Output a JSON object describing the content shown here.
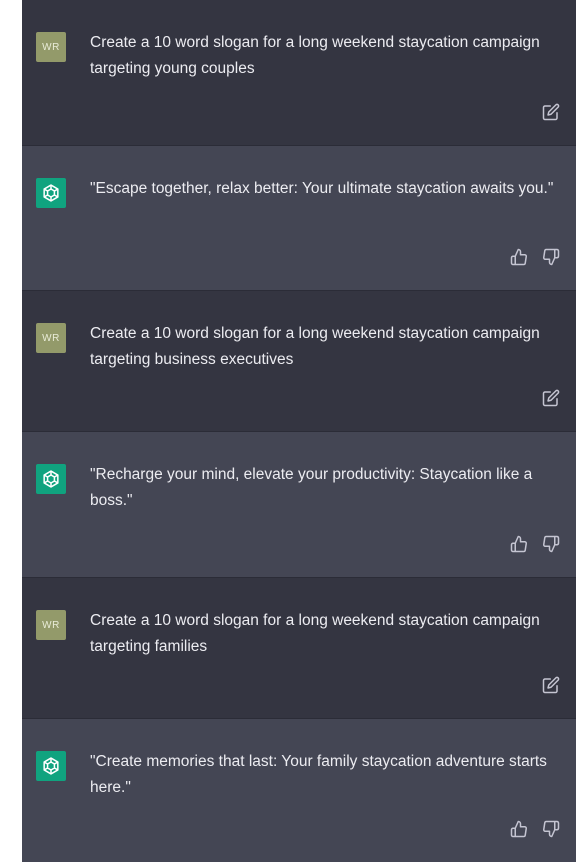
{
  "messages": [
    {
      "role": "user",
      "avatar_text": "WR",
      "text": "Create a 10 word slogan for a long weekend staycation campaign targeting young couples",
      "actions": [
        "edit-icon"
      ]
    },
    {
      "role": "assistant",
      "text": "\"Escape together, relax better: Your ultimate staycation awaits you.\"",
      "actions": [
        "thumbs-up-icon",
        "thumbs-down-icon"
      ]
    },
    {
      "role": "user",
      "avatar_text": "WR",
      "text": "Create a 10 word slogan for a long weekend staycation campaign targeting business executives",
      "actions": [
        "edit-icon"
      ]
    },
    {
      "role": "assistant",
      "text": "\"Recharge your mind, elevate your productivity: Staycation like a boss.\"",
      "actions": [
        "thumbs-up-icon",
        "thumbs-down-icon"
      ]
    },
    {
      "role": "user",
      "avatar_text": "WR",
      "text": "Create a 10 word slogan for a long weekend staycation campaign targeting families",
      "actions": [
        "edit-icon"
      ]
    },
    {
      "role": "assistant",
      "text": "\"Create memories that last: Your family staycation adventure starts here.\"",
      "actions": [
        "thumbs-up-icon",
        "thumbs-down-icon"
      ]
    }
  ],
  "colors": {
    "user_bg": "#343541",
    "assistant_bg": "#444654",
    "user_avatar": "#939a6a",
    "bot_avatar": "#10a37f",
    "text": "#ececf1"
  }
}
